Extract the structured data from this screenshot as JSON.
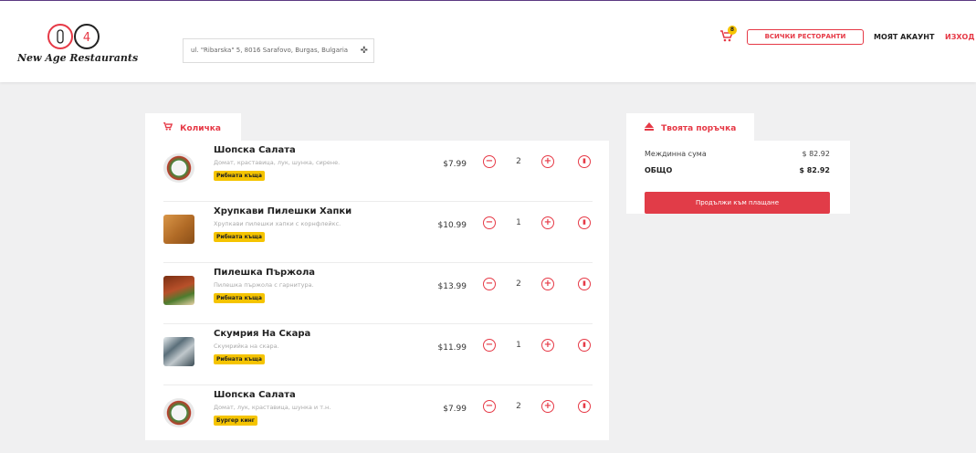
{
  "header": {
    "logo_text": "New Age Restaurants",
    "address": "ul. \"Ribarska\" 5, 8016 Sarafovo, Burgas, Bulgaria",
    "cart_count": "8",
    "all_restaurants": "ВСИЧКИ РЕСТОРАНТИ",
    "my_account": "МОЯТ АКАУНТ",
    "logout": "ИЗХОД"
  },
  "cart_tab": {
    "label": "Количка",
    "icon": "cart-icon"
  },
  "order_tab": {
    "label": "Твоята поръчка",
    "icon": "eject-icon"
  },
  "cart_items": [
    {
      "name": "Шопска Салата",
      "description": "Домат, краставица, лук, шунка, сирене.",
      "restaurant": "Рибната къща",
      "price": "$7.99",
      "qty": "2",
      "image": "salad"
    },
    {
      "name": "Хрупкави Пилешки Хапки",
      "description": "Хрупкави пилешки хапки с корнфлейкс.",
      "restaurant": "Рибната къща",
      "price": "$10.99",
      "qty": "1",
      "image": "chicken"
    },
    {
      "name": "Пилешка Пържола",
      "description": "Пилешка пържола с гарнитура.",
      "restaurant": "Рибната къща",
      "price": "$13.99",
      "qty": "2",
      "image": "steak"
    },
    {
      "name": "Скумрия На Скара",
      "description": "Скумрийка на скара.",
      "restaurant": "Рибната къща",
      "price": "$11.99",
      "qty": "1",
      "image": "fish"
    },
    {
      "name": "Шопска Салата",
      "description": "Домат, лук, краставица, шунка и т.н.",
      "restaurant": "Бургер кинг",
      "price": "$7.99",
      "qty": "2",
      "image": "salad"
    }
  ],
  "order": {
    "subtotal_label": "Междинна сума",
    "subtotal_value": "$ 82.92",
    "total_label": "ОБЩО",
    "total_value": "$ 82.92",
    "checkout_label": "Продължи към плащане"
  },
  "colors": {
    "accent": "#e63946",
    "tag": "#f5c400"
  }
}
